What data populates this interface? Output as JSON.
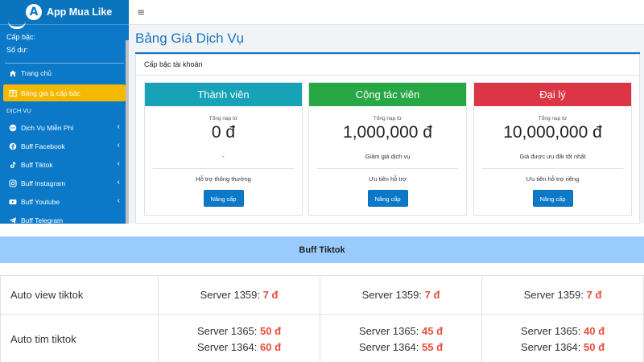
{
  "app": {
    "logo_letter": "A",
    "name": "App Mua Like"
  },
  "user": {
    "level_label": "Cấp bậc:",
    "balance_label": "Số dư:"
  },
  "sidebar": {
    "items": [
      {
        "label": "Trang chủ",
        "icon": "home-icon"
      },
      {
        "label": "Bảng giá & cấp bậc",
        "icon": "table-icon",
        "active": true
      }
    ],
    "section_header": "DỊCH VỤ",
    "services": [
      {
        "label": "Dịch Vụ Miễn Phí",
        "icon": "ellipsis-icon"
      },
      {
        "label": "Buff Facebook",
        "icon": "facebook-icon"
      },
      {
        "label": "Buff Tiktok",
        "icon": "tiktok-icon"
      },
      {
        "label": "Buff Instagram",
        "icon": "instagram-icon"
      },
      {
        "label": "Buff Youtube",
        "icon": "youtube-icon"
      },
      {
        "label": "Buff Telegram",
        "icon": "telegram-icon"
      }
    ]
  },
  "header": {
    "menu_toggle": "≡"
  },
  "page": {
    "title": "Bảng Giá Dịch Vụ",
    "card_title": "Cấp bậc tài khoản",
    "tiers": [
      {
        "name": "Thành viên",
        "color": "#17a2b8",
        "deposit_label": "Tổng nạp từ",
        "price": "0 đ",
        "discount": "-",
        "support": "Hỗ trợ thông thường",
        "button": "Nâng cấp"
      },
      {
        "name": "Cộng tác viên",
        "color": "#28a745",
        "deposit_label": "Tổng nạp từ",
        "price": "1,000,000 đ",
        "discount": "Giảm giá dịch vụ",
        "support": "Ưu tiên hỗ trợ",
        "button": "Nâng cấp"
      },
      {
        "name": "Đại lý",
        "color": "#dc3545",
        "deposit_label": "Tổng nạp từ",
        "price": "10,000,000 đ",
        "discount": "Giá được ưu đãi tốt nhất",
        "support": "Ưu tiên hỗ trợ riêng",
        "button": "Nâng cấp"
      }
    ]
  },
  "price_table": {
    "title": "Buff Tiktok",
    "rows": [
      {
        "service": "Auto view tiktok",
        "cells": [
          [
            {
              "server": "Server 1359:",
              "price": "7 đ"
            }
          ],
          [
            {
              "server": "Server 1359:",
              "price": "7 đ"
            }
          ],
          [
            {
              "server": "Server 1359:",
              "price": "7 đ"
            }
          ]
        ]
      },
      {
        "service": "Auto tim tiktok",
        "cells": [
          [
            {
              "server": "Server 1365:",
              "price": "50 đ"
            },
            {
              "server": "Server 1364:",
              "price": "60 đ"
            }
          ],
          [
            {
              "server": "Server 1365:",
              "price": "45 đ"
            },
            {
              "server": "Server 1364:",
              "price": "55 đ"
            }
          ],
          [
            {
              "server": "Server 1365:",
              "price": "40 đ"
            },
            {
              "server": "Server 1364:",
              "price": "50 đ"
            }
          ]
        ]
      }
    ]
  },
  "colors": {
    "sidebar": "#0b79c8",
    "active_item": "#f5b800",
    "price": "#e74c3c",
    "table_header": "#99cbff"
  }
}
